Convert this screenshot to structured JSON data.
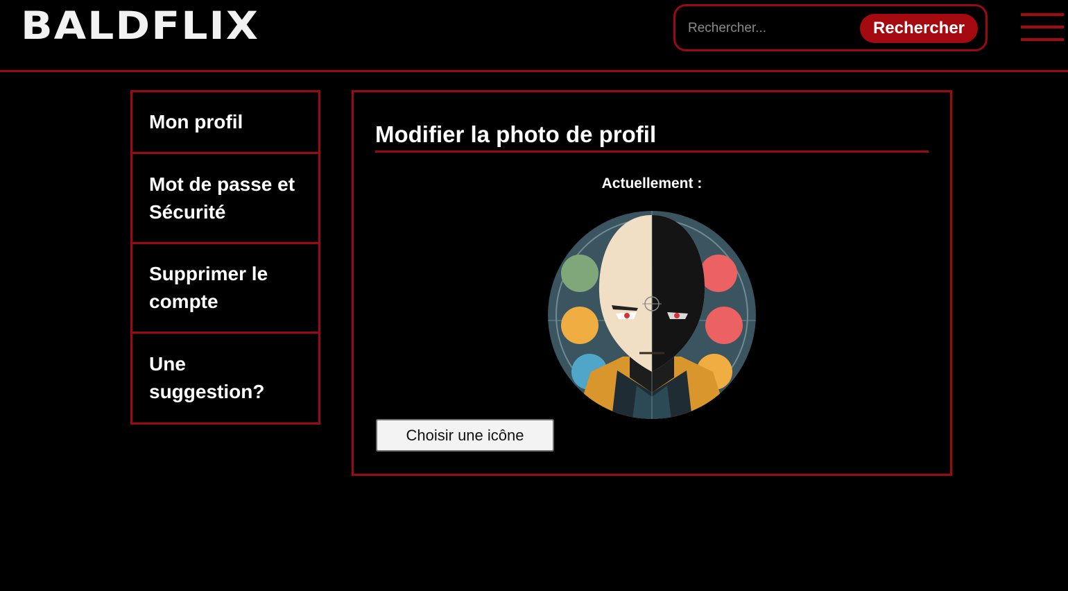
{
  "header": {
    "logo_text": "BALDFLIX",
    "search_placeholder": "Rechercher...",
    "search_button_label": "Rechercher",
    "menu_icon": "hamburger-menu-icon"
  },
  "sidebar": {
    "items": [
      {
        "label": "Mon profil"
      },
      {
        "label": "Mot de passe et Sécurité"
      },
      {
        "label": "Supprimer le compte"
      },
      {
        "label": "Une suggestion?"
      }
    ]
  },
  "main": {
    "title": "Modifier la photo de profil",
    "current_label": "Actuellement :",
    "choose_button_label": "Choisir une icône"
  },
  "colors": {
    "background": "#000000",
    "accent": "#9b0a12",
    "button_red": "#a50a10",
    "text": "#ffffff"
  }
}
